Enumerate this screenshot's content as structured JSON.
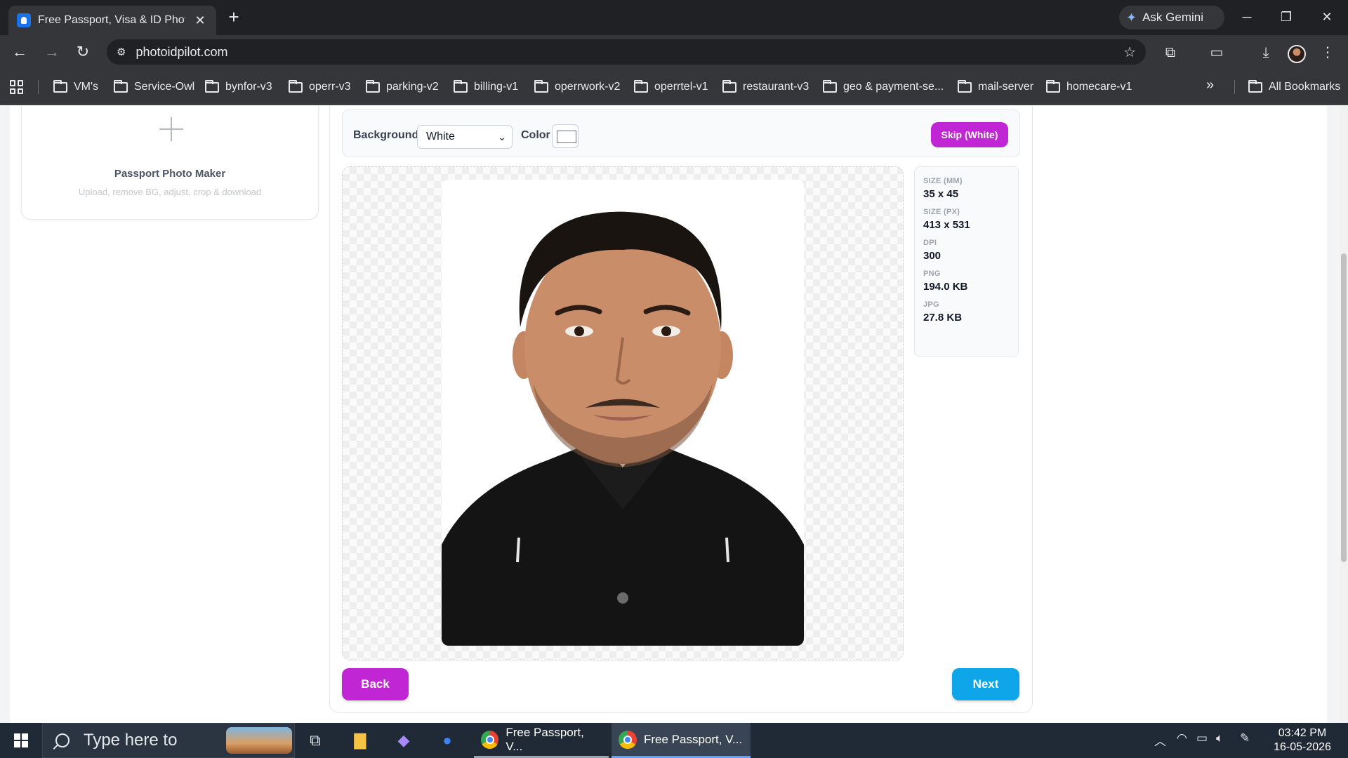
{
  "browser": {
    "tab_title": "Free Passport, Visa & ID Photo Maker",
    "gemini_label": "Ask Gemini",
    "url": "photoidpilot.com",
    "bookmarks": [
      "VM's",
      "Service-Owl",
      "bynfor-v3",
      "operr-v3",
      "parking-v2",
      "billing-v1",
      "operrwork-v2",
      "operrtel-v1",
      "restaurant-v3",
      "geo & payment-se...",
      "mail-server",
      "homecare-v1"
    ],
    "all_bookmarks": "All Bookmarks"
  },
  "left_card": {
    "title": "Passport Photo Maker",
    "subtitle": "Upload, remove BG, adjust, crop & download"
  },
  "controls": {
    "background_label": "Background",
    "background_value": "White",
    "color_label": "Color",
    "color_value": "#ffffff",
    "skip_label": "Skip (White)"
  },
  "info": {
    "size_mm_label": "SIZE (MM)",
    "size_mm_value": "35 x 45",
    "size_px_label": "SIZE (PX)",
    "size_px_value": "413 x 531",
    "dpi_label": "DPI",
    "dpi_value": "300",
    "png_label": "PNG",
    "png_value": "194.0 KB",
    "jpg_label": "JPG",
    "jpg_value": "27.8 KB"
  },
  "actions": {
    "back_label": "Back",
    "next_label": "Next"
  },
  "taskbar": {
    "search_placeholder": "Type here to",
    "apps": [
      "Free Passport, V...",
      "Free Passport, V..."
    ],
    "time": "03:42 PM",
    "date": "16-05-2026"
  },
  "colors": {
    "accent_purple": "#c026d3",
    "accent_blue": "#0ea5e9"
  }
}
